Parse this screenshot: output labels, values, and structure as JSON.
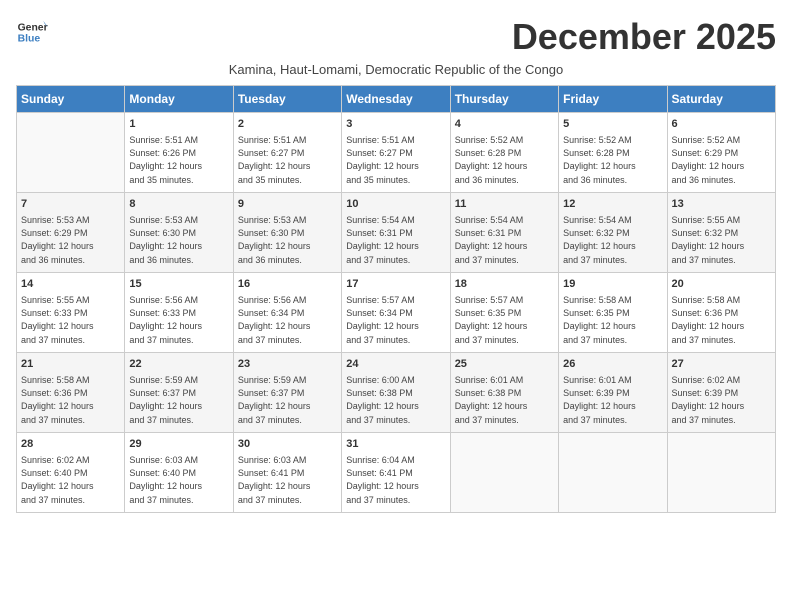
{
  "logo": {
    "line1": "General",
    "line2": "Blue"
  },
  "title": "December 2025",
  "subtitle": "Kamina, Haut-Lomami, Democratic Republic of the Congo",
  "days_of_week": [
    "Sunday",
    "Monday",
    "Tuesday",
    "Wednesday",
    "Thursday",
    "Friday",
    "Saturday"
  ],
  "weeks": [
    [
      {
        "day": "",
        "info": ""
      },
      {
        "day": "1",
        "info": "Sunrise: 5:51 AM\nSunset: 6:26 PM\nDaylight: 12 hours\nand 35 minutes."
      },
      {
        "day": "2",
        "info": "Sunrise: 5:51 AM\nSunset: 6:27 PM\nDaylight: 12 hours\nand 35 minutes."
      },
      {
        "day": "3",
        "info": "Sunrise: 5:51 AM\nSunset: 6:27 PM\nDaylight: 12 hours\nand 35 minutes."
      },
      {
        "day": "4",
        "info": "Sunrise: 5:52 AM\nSunset: 6:28 PM\nDaylight: 12 hours\nand 36 minutes."
      },
      {
        "day": "5",
        "info": "Sunrise: 5:52 AM\nSunset: 6:28 PM\nDaylight: 12 hours\nand 36 minutes."
      },
      {
        "day": "6",
        "info": "Sunrise: 5:52 AM\nSunset: 6:29 PM\nDaylight: 12 hours\nand 36 minutes."
      }
    ],
    [
      {
        "day": "7",
        "info": "Sunrise: 5:53 AM\nSunset: 6:29 PM\nDaylight: 12 hours\nand 36 minutes."
      },
      {
        "day": "8",
        "info": "Sunrise: 5:53 AM\nSunset: 6:30 PM\nDaylight: 12 hours\nand 36 minutes."
      },
      {
        "day": "9",
        "info": "Sunrise: 5:53 AM\nSunset: 6:30 PM\nDaylight: 12 hours\nand 36 minutes."
      },
      {
        "day": "10",
        "info": "Sunrise: 5:54 AM\nSunset: 6:31 PM\nDaylight: 12 hours\nand 37 minutes."
      },
      {
        "day": "11",
        "info": "Sunrise: 5:54 AM\nSunset: 6:31 PM\nDaylight: 12 hours\nand 37 minutes."
      },
      {
        "day": "12",
        "info": "Sunrise: 5:54 AM\nSunset: 6:32 PM\nDaylight: 12 hours\nand 37 minutes."
      },
      {
        "day": "13",
        "info": "Sunrise: 5:55 AM\nSunset: 6:32 PM\nDaylight: 12 hours\nand 37 minutes."
      }
    ],
    [
      {
        "day": "14",
        "info": "Sunrise: 5:55 AM\nSunset: 6:33 PM\nDaylight: 12 hours\nand 37 minutes."
      },
      {
        "day": "15",
        "info": "Sunrise: 5:56 AM\nSunset: 6:33 PM\nDaylight: 12 hours\nand 37 minutes."
      },
      {
        "day": "16",
        "info": "Sunrise: 5:56 AM\nSunset: 6:34 PM\nDaylight: 12 hours\nand 37 minutes."
      },
      {
        "day": "17",
        "info": "Sunrise: 5:57 AM\nSunset: 6:34 PM\nDaylight: 12 hours\nand 37 minutes."
      },
      {
        "day": "18",
        "info": "Sunrise: 5:57 AM\nSunset: 6:35 PM\nDaylight: 12 hours\nand 37 minutes."
      },
      {
        "day": "19",
        "info": "Sunrise: 5:58 AM\nSunset: 6:35 PM\nDaylight: 12 hours\nand 37 minutes."
      },
      {
        "day": "20",
        "info": "Sunrise: 5:58 AM\nSunset: 6:36 PM\nDaylight: 12 hours\nand 37 minutes."
      }
    ],
    [
      {
        "day": "21",
        "info": "Sunrise: 5:58 AM\nSunset: 6:36 PM\nDaylight: 12 hours\nand 37 minutes."
      },
      {
        "day": "22",
        "info": "Sunrise: 5:59 AM\nSunset: 6:37 PM\nDaylight: 12 hours\nand 37 minutes."
      },
      {
        "day": "23",
        "info": "Sunrise: 5:59 AM\nSunset: 6:37 PM\nDaylight: 12 hours\nand 37 minutes."
      },
      {
        "day": "24",
        "info": "Sunrise: 6:00 AM\nSunset: 6:38 PM\nDaylight: 12 hours\nand 37 minutes."
      },
      {
        "day": "25",
        "info": "Sunrise: 6:01 AM\nSunset: 6:38 PM\nDaylight: 12 hours\nand 37 minutes."
      },
      {
        "day": "26",
        "info": "Sunrise: 6:01 AM\nSunset: 6:39 PM\nDaylight: 12 hours\nand 37 minutes."
      },
      {
        "day": "27",
        "info": "Sunrise: 6:02 AM\nSunset: 6:39 PM\nDaylight: 12 hours\nand 37 minutes."
      }
    ],
    [
      {
        "day": "28",
        "info": "Sunrise: 6:02 AM\nSunset: 6:40 PM\nDaylight: 12 hours\nand 37 minutes."
      },
      {
        "day": "29",
        "info": "Sunrise: 6:03 AM\nSunset: 6:40 PM\nDaylight: 12 hours\nand 37 minutes."
      },
      {
        "day": "30",
        "info": "Sunrise: 6:03 AM\nSunset: 6:41 PM\nDaylight: 12 hours\nand 37 minutes."
      },
      {
        "day": "31",
        "info": "Sunrise: 6:04 AM\nSunset: 6:41 PM\nDaylight: 12 hours\nand 37 minutes."
      },
      {
        "day": "",
        "info": ""
      },
      {
        "day": "",
        "info": ""
      },
      {
        "day": "",
        "info": ""
      }
    ]
  ]
}
